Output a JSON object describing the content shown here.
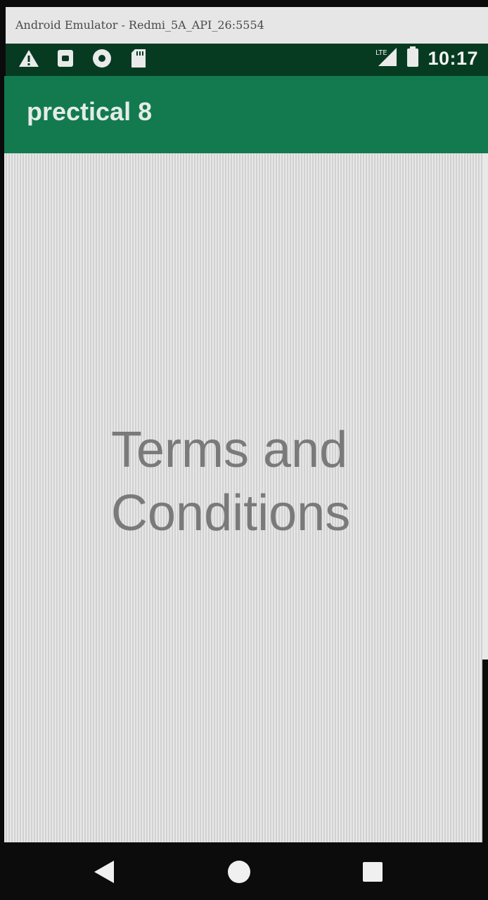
{
  "window": {
    "title": "Android Emulator - Redmi_5A_API_26:5554"
  },
  "status_bar": {
    "time": "10:17",
    "left_icons": [
      "warning-icon",
      "android-notification-icon",
      "circle-notification-icon",
      "sd-card-icon"
    ],
    "right_icons": [
      "signal-icon",
      "battery-icon"
    ]
  },
  "app_bar": {
    "title": "prectical 8",
    "color": "#127a4e"
  },
  "content": {
    "terms_text": "Terms and Conditions"
  },
  "nav_bar": {
    "icons": [
      "back-icon",
      "home-icon",
      "recent-apps-icon"
    ]
  },
  "colors": {
    "status_bar": "#063b22",
    "app_bar": "#127a4e",
    "background": "#dcdcdc",
    "text": "#7a7a7a"
  }
}
